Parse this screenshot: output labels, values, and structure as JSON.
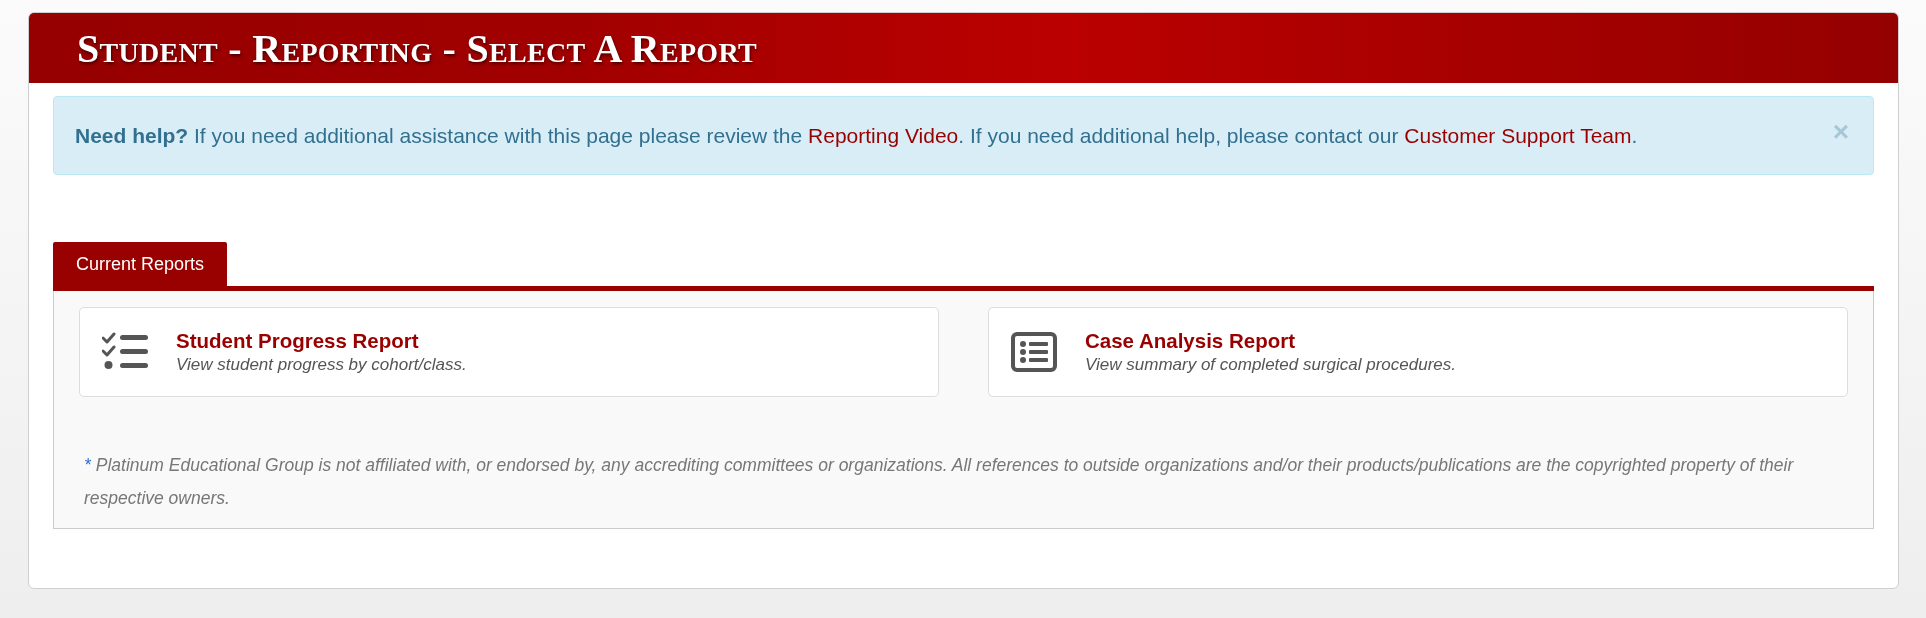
{
  "header": {
    "title": "Student - Reporting - Select A Report"
  },
  "help_alert": {
    "segments": [
      {
        "kind": "text",
        "text": "**Need help?** If you need additional assistance with this page please review the "
      },
      {
        "kind": "link",
        "text": "Reporting Video"
      },
      {
        "kind": "text",
        "text": ". If you need additional help, please contact our "
      },
      {
        "kind": "link",
        "text": "Customer Support Team"
      },
      {
        "kind": "text",
        "text": "."
      }
    ],
    "close": "×"
  },
  "tabs": [
    {
      "label": "Current Reports",
      "selected": true
    }
  ],
  "reports": [
    {
      "kind": "checklist",
      "title": "Student Progress Report",
      "description": "View student progress by cohort/class."
    },
    {
      "kind": "list",
      "title": "Case Analysis Report",
      "description": "View summary of completed surgical procedures."
    }
  ],
  "footnote": {
    "marker": "*",
    "text": "Platinum Educational Group is not affiliated with, or endorsed by, any accrediting committees or organizations. All references to outside organizations and/or their products/publications are the copyrighted property of their respective owners."
  }
}
